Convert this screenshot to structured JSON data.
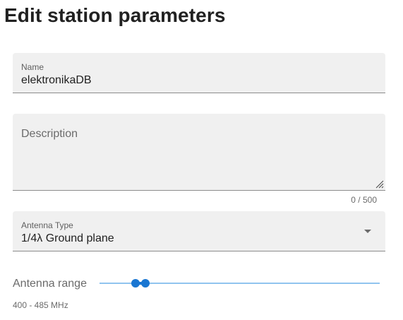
{
  "page": {
    "title": "Edit station parameters"
  },
  "name_field": {
    "label": "Name",
    "value": "elektronikaDB"
  },
  "description_field": {
    "placeholder": "Description",
    "value": "",
    "counter": "0 / 500",
    "max_length": 500
  },
  "antenna_type": {
    "label": "Antenna Type",
    "selected": "1/4λ Ground plane"
  },
  "antenna_range": {
    "label": "Antenna range",
    "readout": "400 - 485 MHz",
    "low_fraction": 0.128,
    "high_fraction": 0.163
  },
  "colors": {
    "accent": "#1976d2",
    "track": "#90c4ef",
    "field_bg": "#f0f0f0"
  }
}
